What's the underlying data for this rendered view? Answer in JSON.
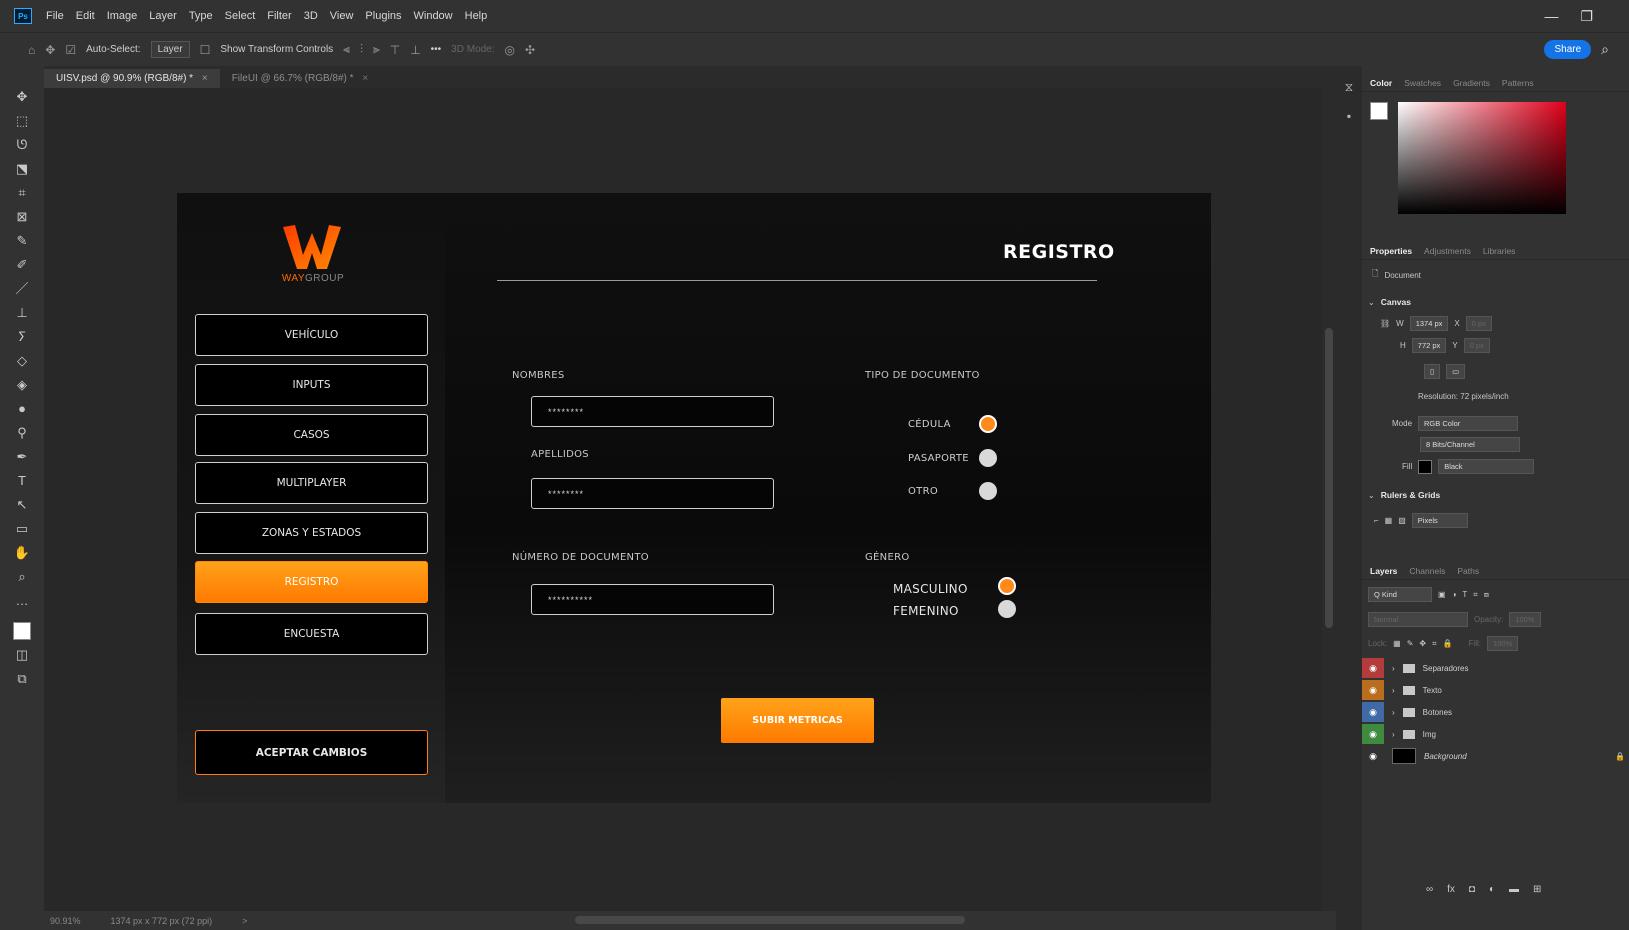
{
  "menubar": {
    "app_badge": "Ps",
    "items": [
      "File",
      "Edit",
      "Image",
      "Layer",
      "Type",
      "Select",
      "Filter",
      "3D",
      "View",
      "Plugins",
      "Window",
      "Help"
    ],
    "minimize": "—",
    "restore": "❐"
  },
  "options": {
    "auto_select_label": "Auto-Select:",
    "layer_select": "Layer",
    "show_transform": "Show Transform Controls",
    "more": "•••",
    "mode_3d": "3D Mode:",
    "share_label": "Share"
  },
  "tabs": [
    {
      "label": "UISV.psd @ 90.9% (RGB/8#) *",
      "close": "×"
    },
    {
      "label": "FileUI @ 66.7% (RGB/8#) *",
      "close": "×"
    }
  ],
  "status": {
    "zoom": "90.91%",
    "doc_info": "1374 px x 772 px (72 ppi)",
    "arrow": ">"
  },
  "artboard": {
    "logo_brand_a": "WAY",
    "logo_brand_b": "GROUP",
    "nav": [
      "VEHÍCULO",
      "INPUTS",
      "CASOS",
      "MULTIPLAYER",
      "ZONAS Y ESTADOS",
      "REGISTRO",
      "ENCUESTA"
    ],
    "accept": "ACEPTAR CAMBIOS",
    "title": "REGISTRO",
    "nombres_label": "NOMBRES",
    "nombres_value": "********",
    "apellidos_label": "APELLIDOS",
    "apellidos_value": "********",
    "num_doc_label": "NÚMERO DE DOCUMENTO",
    "num_doc_value": "**********",
    "tipo_doc_label": "TIPO DE DOCUMENTO",
    "tipo_options": [
      "CÉDULA",
      "PASAPORTE",
      "OTRO"
    ],
    "tipo_selected": "CÉDULA",
    "genero_label": "GÉNERO",
    "genero_options": [
      "MASCULINO",
      "FEMENINO"
    ],
    "genero_selected": "MASCULINO",
    "submit": "SUBIR METRICAS",
    "accent_color": "#ff8a00"
  },
  "right_panel": {
    "color_tabs": [
      "Color",
      "Swatches",
      "Gradients",
      "Patterns"
    ],
    "prop_tabs": [
      "Properties",
      "Adjustments",
      "Libraries"
    ],
    "doc_label": "Document",
    "canvas_title": "Canvas",
    "w_label": "W",
    "w_value": "1374 px",
    "x_label": "X",
    "x_value": "0 px",
    "h_label": "H",
    "h_value": "772 px",
    "y_label": "Y",
    "y_value": "0 px",
    "resolution": "Resolution: 72 pixels/inch",
    "mode_label": "Mode",
    "mode_value": "RGB Color",
    "bits_value": "8 Bits/Channel",
    "fill_label": "Fill",
    "fill_value": "Black",
    "rulers_title": "Rulers & Grids",
    "units": "Pixels",
    "layer_tabs": [
      "Layers",
      "Channels",
      "Paths"
    ],
    "kind": "Q Kind",
    "blend": "Normal",
    "opacity_label": "Opacity:",
    "opacity_value": "100%",
    "lock_label": "Lock:",
    "fill2_label": "Fill:",
    "fill2_value": "100%",
    "layers": [
      {
        "name": "Separadores",
        "color": "#b33b3b"
      },
      {
        "name": "Texto",
        "color": "#b86e1e"
      },
      {
        "name": "Botones",
        "color": "#3f6aa6"
      },
      {
        "name": "Img",
        "color": "#3f8a3f"
      }
    ],
    "background_layer": "Background"
  }
}
